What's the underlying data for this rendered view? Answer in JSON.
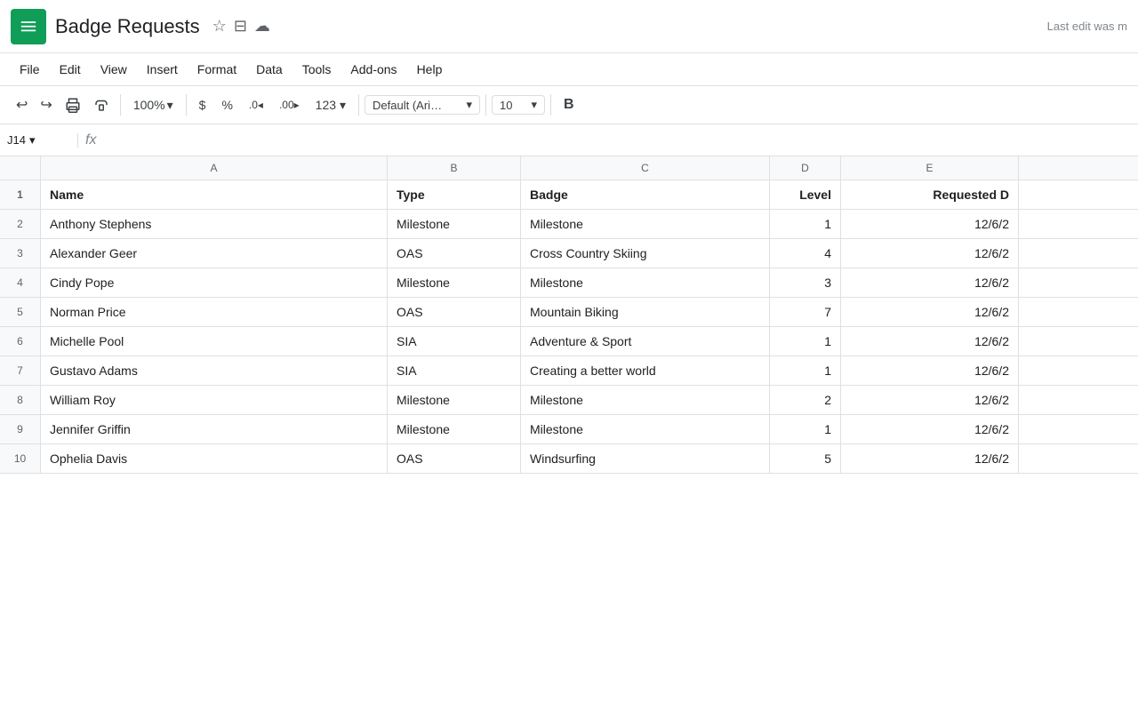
{
  "app": {
    "icon_alt": "Google Sheets",
    "title": "Badge Requests",
    "last_edit": "Last edit was m"
  },
  "title_icons": {
    "star": "☆",
    "folder": "⇥",
    "cloud": "☁"
  },
  "menu": {
    "items": [
      "File",
      "Edit",
      "View",
      "Insert",
      "Format",
      "Data",
      "Tools",
      "Add-ons",
      "Help"
    ]
  },
  "toolbar": {
    "undo": "↩",
    "redo": "↪",
    "print": "🖨",
    "paint": "🖌",
    "zoom": "100%",
    "currency": "$",
    "percent": "%",
    "decimal_less": ".0",
    "decimal_more": ".00",
    "number_format": "123",
    "font": "Default (Ari…",
    "font_size": "10",
    "bold": "B"
  },
  "formula_bar": {
    "cell_ref": "J14",
    "formula_icon": "fx"
  },
  "columns": {
    "headers": [
      "A",
      "B",
      "C",
      "D",
      "E"
    ],
    "names": [
      "Name",
      "Type",
      "Badge",
      "Level",
      "Requested D"
    ]
  },
  "rows": [
    {
      "num": "2",
      "name": "Anthony Stephens",
      "type": "Milestone",
      "badge": "Milestone",
      "level": "1",
      "date": "12/6/2"
    },
    {
      "num": "3",
      "name": "Alexander Geer",
      "type": "OAS",
      "badge": "Cross Country Skiing",
      "level": "4",
      "date": "12/6/2"
    },
    {
      "num": "4",
      "name": "Cindy Pope",
      "type": "Milestone",
      "badge": "Milestone",
      "level": "3",
      "date": "12/6/2"
    },
    {
      "num": "5",
      "name": "Norman Price",
      "type": "OAS",
      "badge": "Mountain Biking",
      "level": "7",
      "date": "12/6/2"
    },
    {
      "num": "6",
      "name": "Michelle Pool",
      "type": "SIA",
      "badge": "Adventure & Sport",
      "level": "1",
      "date": "12/6/2"
    },
    {
      "num": "7",
      "name": "Gustavo Adams",
      "type": "SIA",
      "badge": "Creating a better world",
      "level": "1",
      "date": "12/6/2"
    },
    {
      "num": "8",
      "name": "William Roy",
      "type": "Milestone",
      "badge": "Milestone",
      "level": "2",
      "date": "12/6/2"
    },
    {
      "num": "9",
      "name": "Jennifer Griffin",
      "type": "Milestone",
      "badge": "Milestone",
      "level": "1",
      "date": "12/6/2"
    },
    {
      "num": "10",
      "name": "Ophelia Davis",
      "type": "OAS",
      "badge": "Windsurfing",
      "level": "5",
      "date": "12/6/2"
    }
  ]
}
